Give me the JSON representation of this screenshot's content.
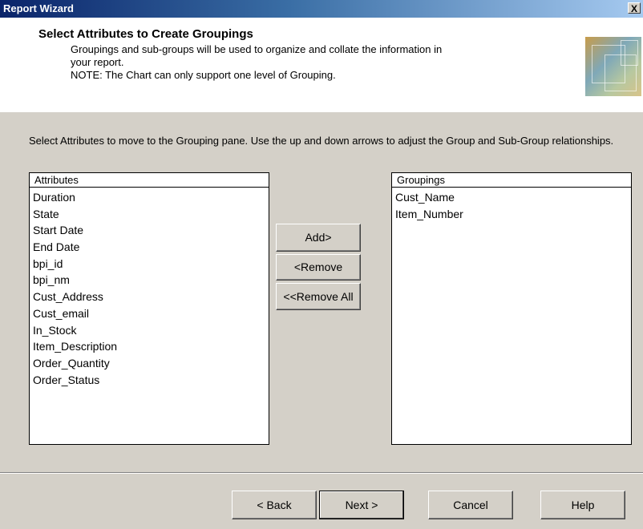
{
  "window": {
    "title": "Report Wizard",
    "close_glyph": "X"
  },
  "header": {
    "title": "Select Attributes to Create Groupings",
    "lines": [
      "Groupings and sub-groups will be used to organize and collate the information in",
      "your report.",
      "NOTE: The Chart can only support one level of Grouping."
    ]
  },
  "instructions": "Select Attributes to move to the Grouping pane.  Use the up and down arrows to adjust the Group and Sub-Group relationships.",
  "attributes": {
    "label": "Attributes",
    "items": [
      "Duration",
      "State",
      "Start Date",
      "End Date",
      "bpi_id",
      "bpi_nm",
      "Cust_Address",
      "Cust_email",
      "In_Stock",
      "Item_Description",
      "Order_Quantity",
      "Order_Status"
    ]
  },
  "groupings": {
    "label": "Groupings",
    "items": [
      "Cust_Name",
      "Item_Number"
    ]
  },
  "actions": {
    "add": "Add>",
    "remove": "<Remove",
    "remove_all": "<<Remove All"
  },
  "footer": {
    "back": "< Back",
    "next": "Next >",
    "cancel": "Cancel",
    "help": "Help"
  }
}
